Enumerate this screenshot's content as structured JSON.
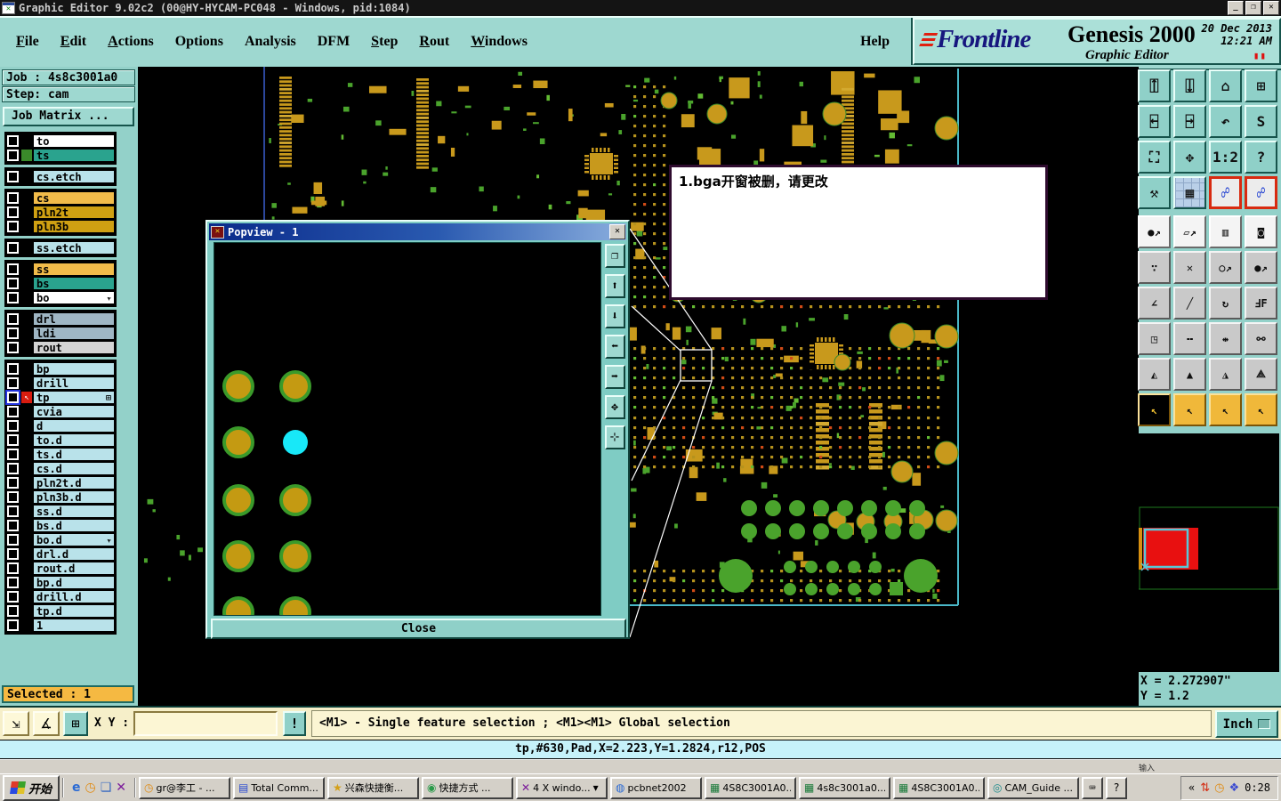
{
  "palette": {
    "ui_teal": "#93d1c9",
    "board_black": "#000000",
    "pad_olive": "#c8991c",
    "pad_green": "#4aa32c",
    "pad_cyan": "#18e8f8",
    "accent_red": "#d82a10",
    "select_orange": "#f5b942",
    "info_cyan": "#c6f2fa"
  },
  "titlebar": {
    "title": "Graphic Editor 9.02c2 (00@HY-HYCAM-PC048 - Windows, pid:1084)",
    "icon_glyph": "✕",
    "controls": [
      {
        "n": "minimize-button",
        "g": "_"
      },
      {
        "n": "restore-button",
        "g": "❐"
      },
      {
        "n": "close-button",
        "g": "✕"
      }
    ]
  },
  "menubar": {
    "menus": [
      {
        "label": "File",
        "u": true
      },
      {
        "label": "Edit",
        "u": true
      },
      {
        "label": "Actions",
        "u": true
      },
      {
        "label": "Options",
        "u": false
      },
      {
        "label": "Analysis",
        "u": false
      },
      {
        "label": "DFM",
        "u": false
      },
      {
        "label": "Step",
        "u": true
      },
      {
        "label": "Rout",
        "u": true
      },
      {
        "label": "Windows",
        "u": true
      }
    ],
    "help": "Help"
  },
  "brand": {
    "logo_text": "Frontline",
    "product": "Genesis 2000",
    "date": "20 Dec 2013",
    "time": "12:21 AM",
    "subtitle": "Graphic Editor",
    "pause_glyph": "▮▮"
  },
  "sidebar": {
    "job": "Job : 4s8c3001a0",
    "step": "Step: cam",
    "job_matrix": "Job Matrix ...",
    "selected": "Selected : 1",
    "sel_arrow": "↖",
    "row_arrow": "➤",
    "tp_badge": "⊞",
    "layer_groups": [
      {
        "rows": [
          {
            "label": "to",
            "bg": "#ffffff"
          },
          {
            "label": "ts",
            "bg": "#2aa38e",
            "swatch": "#3a8a2a"
          }
        ]
      },
      {
        "rows": [
          {
            "label": "cs.etch",
            "bg": "#b9e2ea"
          }
        ]
      },
      {
        "rows": [
          {
            "label": "cs",
            "bg": "#f2bc4a"
          },
          {
            "label": "pln2t",
            "bg": "#cfa012"
          },
          {
            "label": "pln3b",
            "bg": "#cfa012"
          }
        ]
      },
      {
        "rows": [
          {
            "label": "ss.etch",
            "bg": "#b9e2ea"
          }
        ]
      },
      {
        "rows": [
          {
            "label": "ss",
            "bg": "#f2bc4a"
          },
          {
            "label": "bs",
            "bg": "#2aa38e"
          },
          {
            "label": "bo",
            "bg": "#ffffff",
            "arrow": true
          }
        ]
      },
      {
        "rows": [
          {
            "label": "drl",
            "bg": "#9fb6c4"
          },
          {
            "label": "ldi",
            "bg": "#9fb6c4"
          },
          {
            "label": "rout",
            "bg": "#d4d4d4"
          }
        ]
      },
      {
        "rows": [
          {
            "label": "bp",
            "bg": "#b9e2ea"
          },
          {
            "label": "drill",
            "bg": "#b9e2ea"
          },
          {
            "label": "tp",
            "bg": "#b9e2ea",
            "selected": true
          },
          {
            "label": "cvia",
            "bg": "#b9e2ea"
          },
          {
            "label": "d",
            "bg": "#b9e2ea"
          },
          {
            "label": "to.d",
            "bg": "#b9e2ea"
          },
          {
            "label": "ts.d",
            "bg": "#b9e2ea"
          },
          {
            "label": "cs.d",
            "bg": "#b9e2ea"
          },
          {
            "label": "pln2t.d",
            "bg": "#b9e2ea"
          },
          {
            "label": "pln3b.d",
            "bg": "#b9e2ea"
          },
          {
            "label": "ss.d",
            "bg": "#b9e2ea"
          },
          {
            "label": "bs.d",
            "bg": "#b9e2ea"
          },
          {
            "label": "bo.d",
            "bg": "#b9e2ea",
            "arrow": true
          },
          {
            "label": "drl.d",
            "bg": "#b9e2ea"
          },
          {
            "label": "rout.d",
            "bg": "#b9e2ea"
          },
          {
            "label": "bp.d",
            "bg": "#b9e2ea"
          },
          {
            "label": "drill.d",
            "bg": "#b9e2ea"
          },
          {
            "label": "tp.d",
            "bg": "#b9e2ea"
          },
          {
            "label": "1",
            "bg": "#b9e2ea"
          }
        ]
      }
    ]
  },
  "popview": {
    "title": "Popview - 1",
    "icon_glyph": "✕",
    "close_icon": "✕",
    "close_label": "Close",
    "tools": [
      {
        "n": "popview-popout-icon",
        "g": "❐"
      },
      {
        "n": "popview-zoom-in-icon",
        "g": "⬆"
      },
      {
        "n": "popview-zoom-out-icon",
        "g": "⬇"
      },
      {
        "n": "popview-pan-left-icon",
        "g": "⬅"
      },
      {
        "n": "popview-pan-right-icon",
        "g": "➡"
      },
      {
        "n": "popview-fit-view-icon",
        "g": "✥"
      },
      {
        "n": "popview-center-view-icon",
        "g": "⊹"
      }
    ]
  },
  "annotation": {
    "text": "1.bga开窗被删，请更改"
  },
  "toolbar": {
    "view_buttons": [
      {
        "n": "zoom-in-button",
        "g": "⍐",
        "t": "t"
      },
      {
        "n": "zoom-out-button",
        "g": "⍗",
        "t": "t"
      },
      {
        "n": "home-view-button",
        "g": "⌂",
        "t": "t"
      },
      {
        "n": "split-window-xy-button",
        "g": "⊞",
        "t": "t"
      },
      {
        "n": "pan-left-button",
        "g": "⍇",
        "t": "t"
      },
      {
        "n": "pan-right-button",
        "g": "⍈",
        "t": "t"
      },
      {
        "n": "previous-view-button",
        "g": "↶",
        "t": "t"
      },
      {
        "n": "s-route-button",
        "g": "S",
        "t": "t"
      },
      {
        "n": "fit-view-button",
        "g": "⛶",
        "t": "t"
      },
      {
        "n": "center-view-button",
        "g": "✥",
        "t": "t"
      },
      {
        "n": "scale-1-2-button",
        "g": "1:2",
        "t": "t"
      },
      {
        "n": "help-button",
        "g": "?",
        "t": "t"
      },
      {
        "n": "setup-tools-button",
        "g": "⚒",
        "t": "t"
      },
      {
        "n": "snap-grid-button",
        "g": "▦",
        "t": "grid"
      },
      {
        "n": "netlist-a-button",
        "g": "☍",
        "t": "r"
      },
      {
        "n": "netlist-b-button",
        "g": "☍",
        "t": "r"
      }
    ],
    "edit_buttons": [
      {
        "n": "move-feature-button",
        "g": "●↗",
        "t": "w"
      },
      {
        "n": "copy-feature-button",
        "g": "▱↗",
        "t": "w"
      },
      {
        "n": "measure-button",
        "g": "▥",
        "t": "w"
      },
      {
        "n": "select-pad-button",
        "g": "◙",
        "t": "w"
      },
      {
        "n": "net-endpoints-button",
        "g": "∵",
        "t": "g"
      },
      {
        "n": "delete-feature-button",
        "g": "✕",
        "t": "g"
      },
      {
        "n": "grow-pad-button",
        "g": "○↗",
        "t": "g"
      },
      {
        "n": "swap-pad-button",
        "g": "●↗",
        "t": "g"
      },
      {
        "n": "angle-measure-button",
        "g": "∠",
        "t": "g"
      },
      {
        "n": "draw-line-button",
        "g": "╱",
        "t": "g"
      },
      {
        "n": "rotate-feature-button",
        "g": "↻",
        "t": "g"
      },
      {
        "n": "mirror-feature-button",
        "g": "ℲF",
        "t": "g"
      },
      {
        "n": "copy-pad-button",
        "g": "◳",
        "t": "g"
      },
      {
        "n": "break-line-button",
        "g": "╍",
        "t": "g"
      },
      {
        "n": "spacing-check-button",
        "g": "⇹",
        "t": "g"
      },
      {
        "n": "touching-check-button",
        "g": "⚯",
        "t": "g"
      },
      {
        "n": "triangle-up-a-button",
        "g": "◭",
        "t": "g"
      },
      {
        "n": "triangle-up-b-button",
        "g": "▲",
        "t": "g"
      },
      {
        "n": "triangle-up-c-button",
        "g": "◮",
        "t": "g"
      },
      {
        "n": "triangle-up-d-button",
        "g": "⟁",
        "t": "g"
      },
      {
        "n": "select-cursor-button",
        "g": "↖",
        "t": "sel"
      },
      {
        "n": "select-inside-button",
        "g": "↖",
        "t": "a"
      },
      {
        "n": "select-outside-button",
        "g": "↖",
        "t": "a"
      },
      {
        "n": "select-net-button",
        "g": "↖",
        "t": "a"
      }
    ]
  },
  "coords": {
    "x": "X = 2.272907\"",
    "y": "Y = 1.2"
  },
  "units": {
    "label": "Inch"
  },
  "statusbar": {
    "tools": [
      {
        "n": "resize-tool-button",
        "g": "⇲"
      },
      {
        "n": "angle-tool-button",
        "g": "∡"
      },
      {
        "n": "grid-tool-button",
        "g": "⊞",
        "teal": true
      }
    ],
    "xy_label": "X Y :",
    "xy_value": "",
    "alert": "!",
    "message": "<M1> - Single feature selection ; <M1><M1> Global selection"
  },
  "infobar": {
    "text": "tp,#630,Pad,X=2.223,Y=1.2824,r12,POS"
  },
  "langstrip": {
    "text": "输入"
  },
  "taskbar": {
    "start": "开始",
    "quick": [
      {
        "n": "ie-icon",
        "g": "e",
        "c": "#2a6ad4"
      },
      {
        "n": "clock-icon",
        "g": "◷",
        "c": "#e08a10"
      },
      {
        "n": "notes-icon",
        "g": "❏",
        "c": "#3a6ac0"
      },
      {
        "n": "purple-x-icon",
        "g": "✕",
        "c": "#7a1a9a"
      }
    ],
    "buttons": [
      {
        "icon": "◷",
        "ic": "#e08a10",
        "label": "gr@李工 - ..."
      },
      {
        "icon": "▤",
        "ic": "#2a4ad0",
        "label": "Total Comm..."
      },
      {
        "icon": "★",
        "ic": "#d4a018",
        "label": "兴森快捷衡..."
      },
      {
        "icon": "◉",
        "ic": "#2a9a4a",
        "label": "快捷方式 ..."
      },
      {
        "icon": "✕",
        "ic": "#7a1a9a",
        "label": "4 X windo...",
        "drop": "▾"
      },
      {
        "icon": "◍",
        "ic": "#2a6ad4",
        "label": "pcbnet2002"
      },
      {
        "icon": "▦",
        "ic": "#1a7a3a",
        "label": "4S8C3001A0..."
      },
      {
        "icon": "▦",
        "ic": "#1a7a3a",
        "label": "4s8c3001a0..."
      },
      {
        "icon": "▦",
        "ic": "#1a7a3a",
        "label": "4S8C3001A0..."
      },
      {
        "icon": "◎",
        "ic": "#1a8a8a",
        "label": "CAM_Guide ..."
      }
    ],
    "kbd": "⌨",
    "help": "?",
    "tray_chevron": "«",
    "tray_icons": [
      {
        "n": "signal-icon",
        "g": "⇅",
        "c": "#d42a10"
      },
      {
        "n": "tray-clock-icon",
        "g": "◷",
        "c": "#e08a10"
      },
      {
        "n": "network-icon",
        "g": "❖",
        "c": "#3a4ad0"
      }
    ],
    "time": "0:28"
  }
}
